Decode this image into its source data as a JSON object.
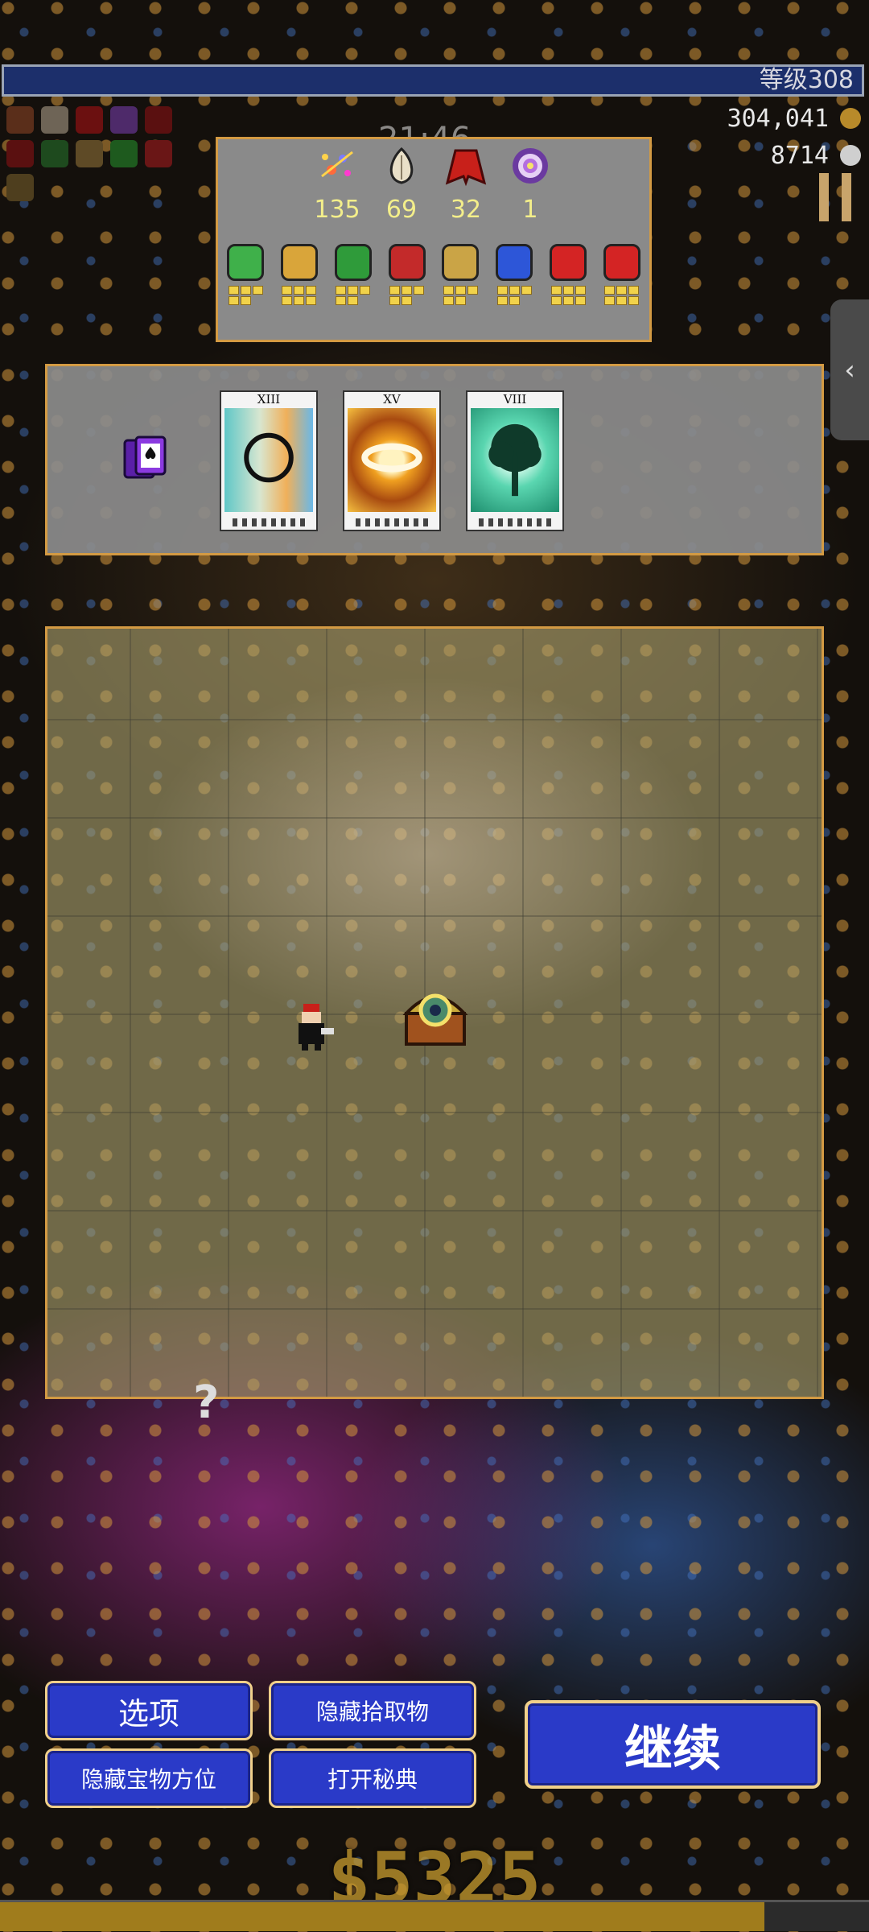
{
  "hud": {
    "level_label": "等级308",
    "timer": "21:46",
    "gold_collected": "304,041",
    "kill_count": "8714",
    "top_icons": [
      "firework-icon",
      "garlic-icon",
      "red-cloak-icon",
      "target-icon",
      "x-icon",
      "x-icon",
      "green-flower-icon",
      "bone-icon",
      "clover-icon",
      "book-icon",
      "candelabra-icon"
    ]
  },
  "inventory": {
    "weapons": [
      {
        "icon": "fireworks-icon",
        "count": "135",
        "color": "#ff6a3a"
      },
      {
        "icon": "garlic-icon",
        "count": "69",
        "color": "#e9e0c8"
      },
      {
        "icon": "red-cloak-icon",
        "count": "32",
        "color": "#c8201a"
      },
      {
        "icon": "target-icon",
        "count": "1",
        "color": "#b46ee0"
      }
    ],
    "passives": [
      {
        "icon": "feather-icon",
        "color": "#3fb04a",
        "levels": 5
      },
      {
        "icon": "bracer-icon",
        "color": "#d9a53a",
        "levels": 6
      },
      {
        "icon": "clover-icon",
        "color": "#2f9b3a",
        "levels": 5
      },
      {
        "icon": "tome-icon",
        "color": "#c32a2a",
        "levels": 5
      },
      {
        "icon": "candelabra-icon",
        "color": "#caa446",
        "levels": 5
      },
      {
        "icon": "orb-icon",
        "color": "#2d56d8",
        "levels": 5
      },
      {
        "icon": "arrow-attractor-icon",
        "color": "#d42424",
        "levels": 6
      },
      {
        "icon": "arrow-attractor-icon",
        "color": "#d42424",
        "levels": 6
      }
    ]
  },
  "arcana": {
    "cards": [
      {
        "numeral": "XIII",
        "art": "circle-ring"
      },
      {
        "numeral": "XV",
        "art": "golden-ring"
      },
      {
        "numeral": "VIII",
        "art": "tree"
      }
    ]
  },
  "buttons": {
    "options": "选项",
    "hide_pickups": "隐藏拾取物",
    "hide_treasure": "隐藏宝物方位",
    "open_grimoire": "打开秘典",
    "continue": "继续"
  },
  "bottom": {
    "gold": "$5325",
    "xp_progress": 0.88
  },
  "colors": {
    "panel_border": "#d39a43",
    "button_bg": "#2a3ac8",
    "level_bar": "#1c2f6b"
  }
}
